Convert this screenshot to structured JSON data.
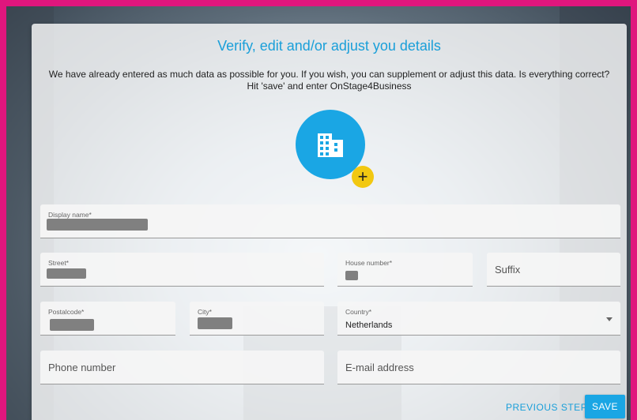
{
  "dialog": {
    "title": "Verify, edit and/or adjust you details",
    "intro": "We have already entered as much data as possible for you. If you wish, you can supplement or adjust this data. Is everything correct? Hit 'save' and enter OnStage4Business"
  },
  "avatar": {
    "icon": "building-icon",
    "add_icon": "plus-icon",
    "add_label": "+"
  },
  "fields": {
    "display_name": {
      "label": "Display name*"
    },
    "street": {
      "label": "Street*"
    },
    "house_number": {
      "label": "House number*"
    },
    "suffix": {
      "placeholder": "Suffix"
    },
    "postalcode": {
      "label": "Postalcode*"
    },
    "city": {
      "label": "City*"
    },
    "country": {
      "label": "Country*",
      "value": "Netherlands"
    },
    "phone": {
      "placeholder": "Phone number"
    },
    "email": {
      "placeholder": "E-mail address"
    }
  },
  "actions": {
    "previous_label": "PREVIOUS STEP",
    "save_label": "SAVE"
  },
  "colors": {
    "accent": "#1aa6e4",
    "frame": "#e0167d",
    "add_button": "#f2c811"
  }
}
